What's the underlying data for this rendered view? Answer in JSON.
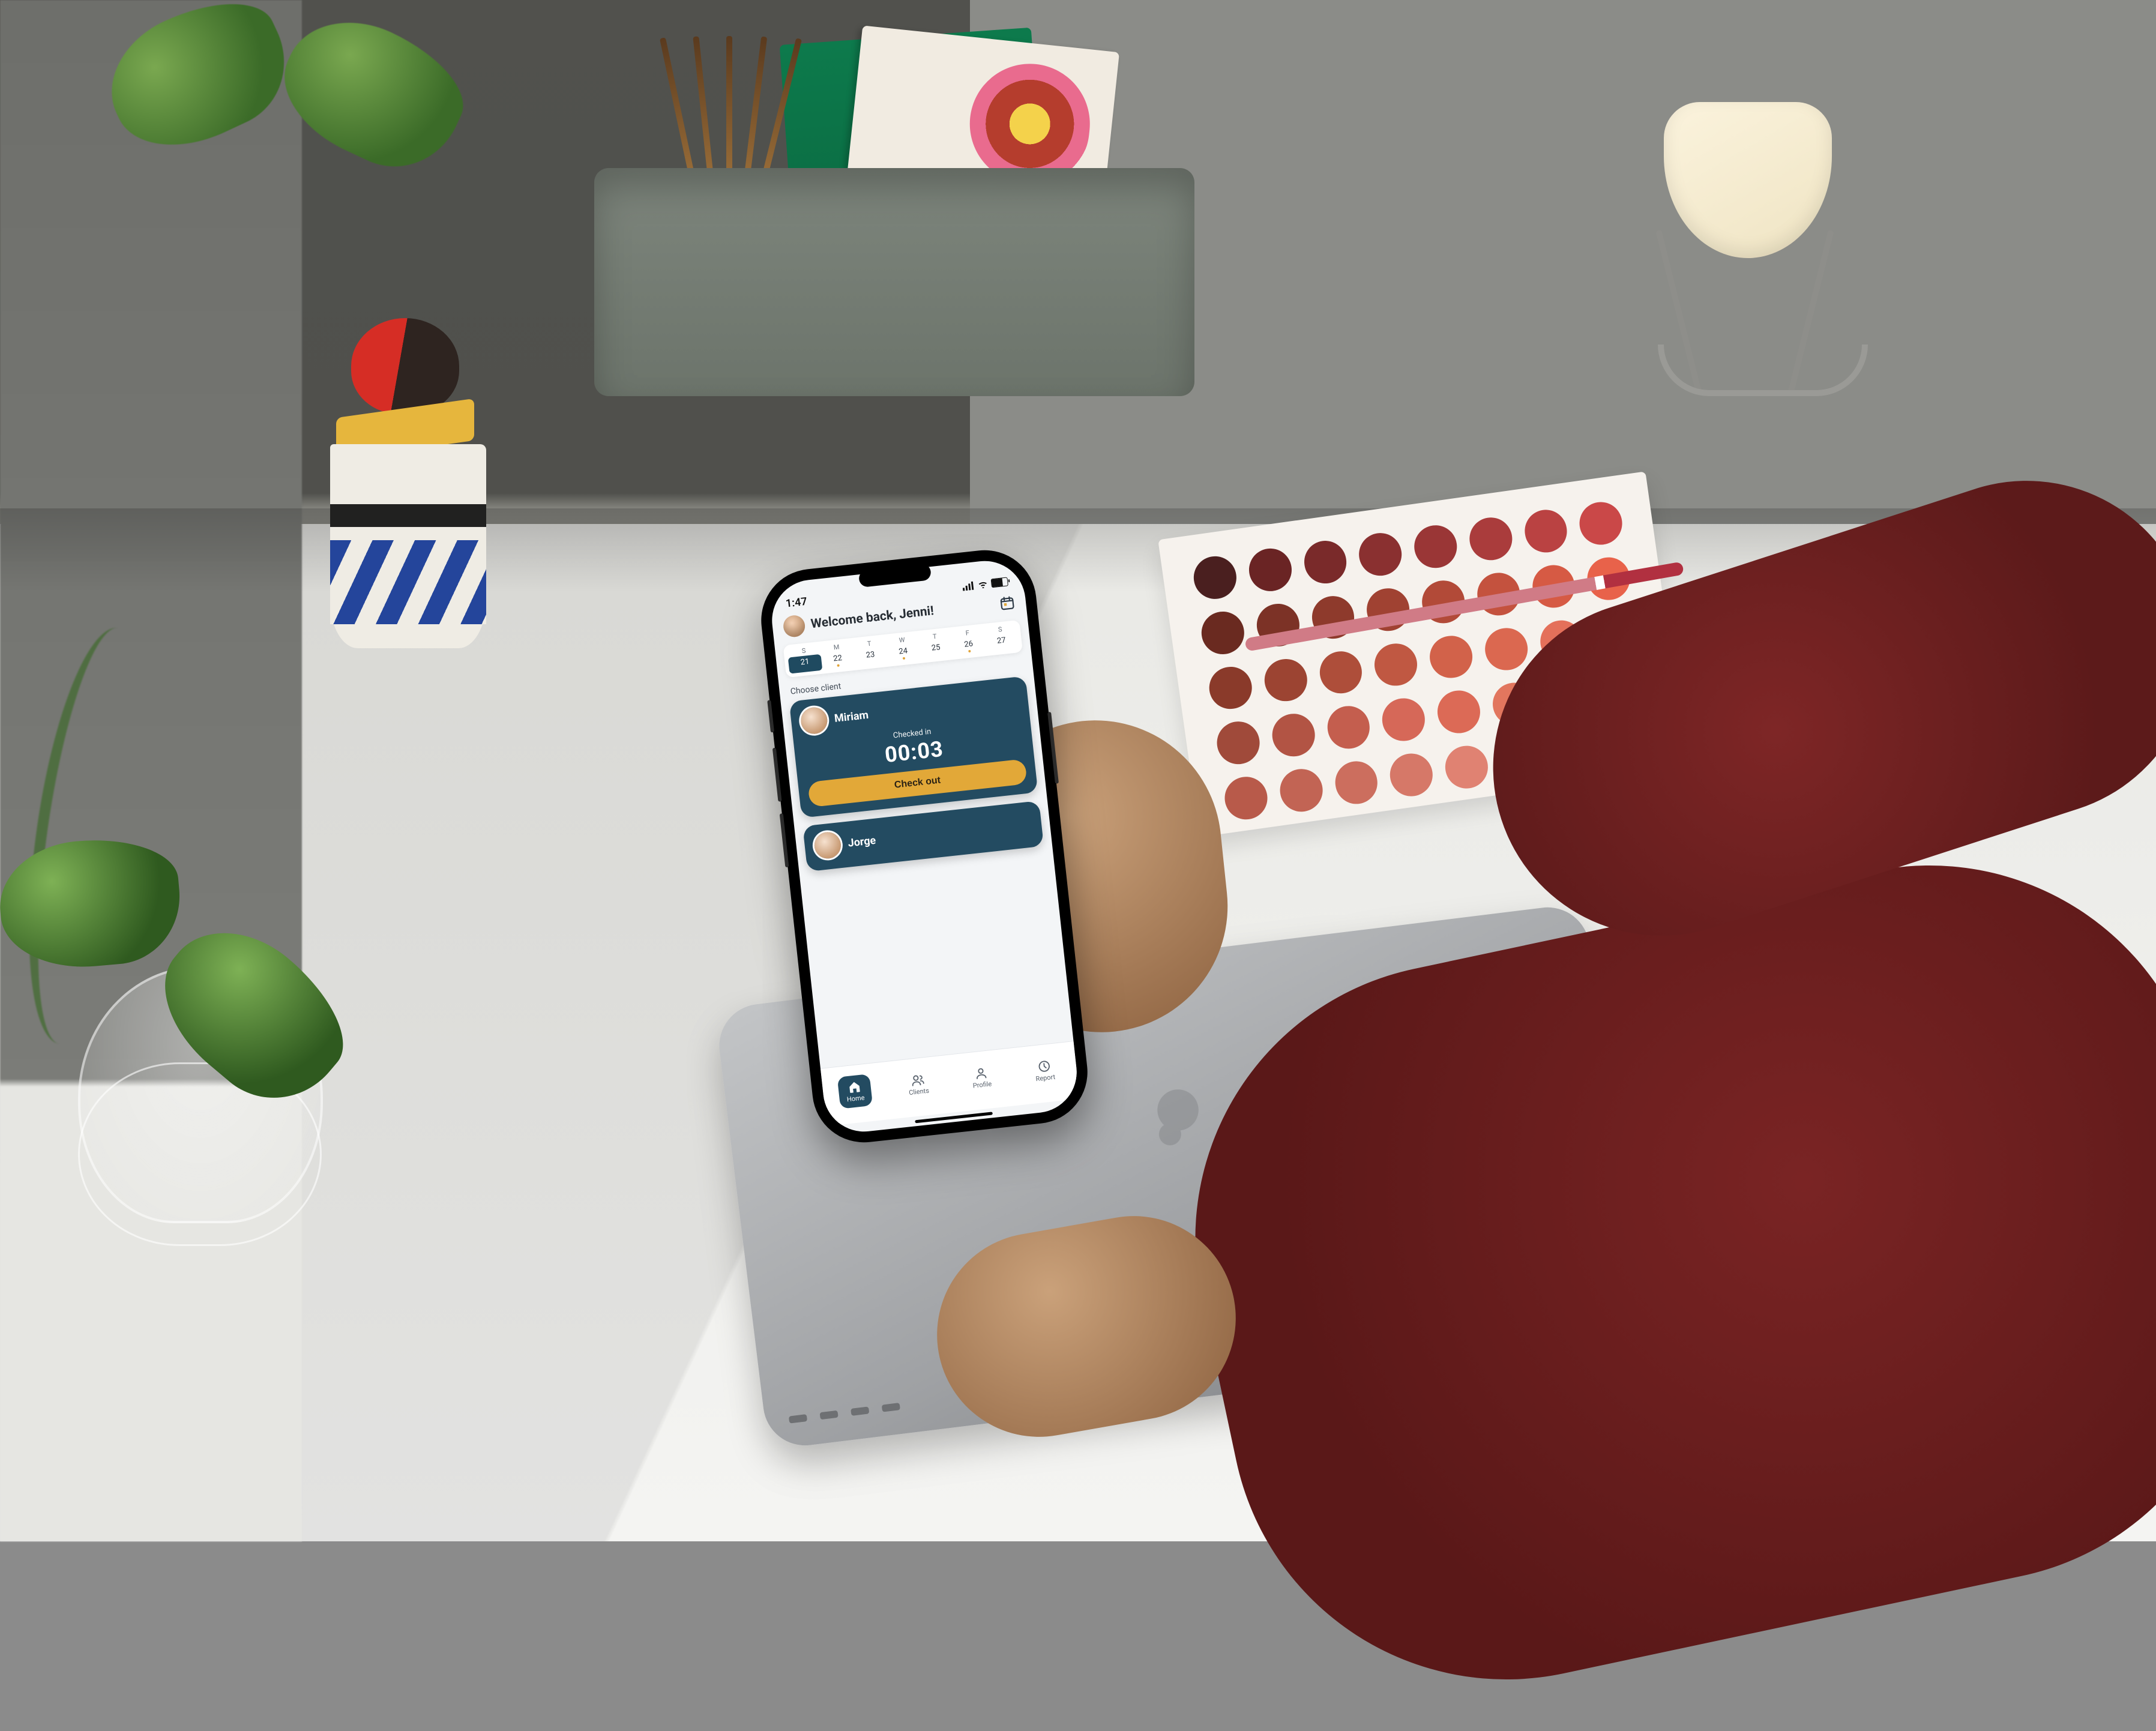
{
  "status": {
    "time": "1:47"
  },
  "header": {
    "welcome": "Welcome back, Jenni!",
    "calendar_icon": "calendar-icon"
  },
  "calendar": {
    "dow": [
      "S",
      "M",
      "T",
      "W",
      "T",
      "F",
      "S"
    ],
    "days": [
      "21",
      "22",
      "23",
      "24",
      "25",
      "26",
      "27"
    ],
    "today_index": 0
  },
  "section_label": "Choose client",
  "clients": {
    "primary": {
      "name": "Miriam",
      "status_label": "Checked in",
      "timer": "00:03",
      "button": "Check out"
    },
    "secondary": {
      "name": "Jorge"
    }
  },
  "tabs": {
    "home": "Home",
    "clients": "Clients",
    "profile": "Profile",
    "report": "Report"
  },
  "palette_colors": [
    "#4a1f1f",
    "#6a2424",
    "#7a2a2a",
    "#8a3030",
    "#9a3636",
    "#aa3c3c",
    "#ba4242",
    "#ca4848",
    "#6a2a20",
    "#7c3226",
    "#8e3a2c",
    "#a04232",
    "#b24a38",
    "#c4523e",
    "#d65a44",
    "#e8624a",
    "#8a3a2a",
    "#9c4432",
    "#ae4e3a",
    "#c05842",
    "#d2624a",
    "#db6850",
    "#e4705a",
    "#ee7862",
    "#a04a3a",
    "#b25444",
    "#c45e4e",
    "#d66858",
    "#dc6a56",
    "#e2765e",
    "#e88068",
    "#ee8a72",
    "#b85a4a",
    "#c26454",
    "#cc6e5e",
    "#d67868",
    "#e08272",
    "#e88a78",
    "#ee927e",
    "#f49a84"
  ]
}
